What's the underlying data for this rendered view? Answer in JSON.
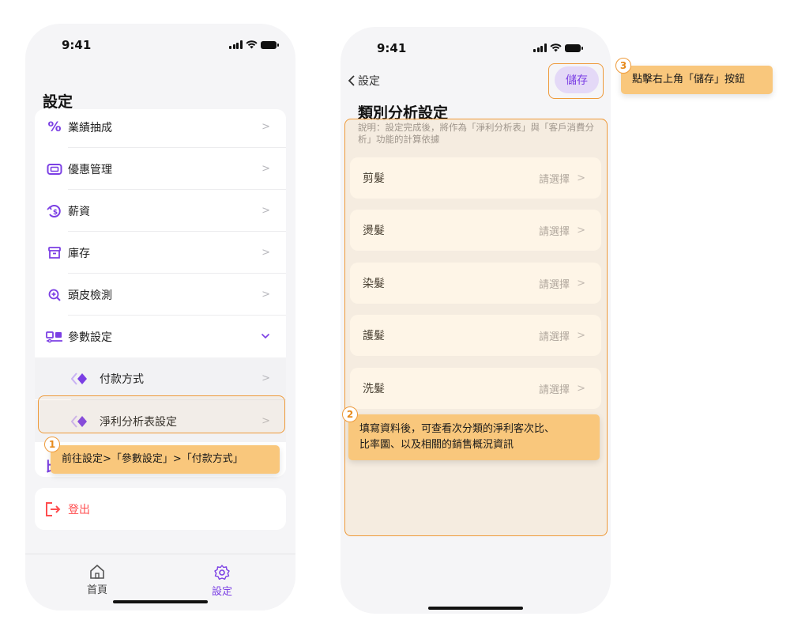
{
  "phone1": {
    "status": {
      "time": "9:41"
    },
    "title": "設定",
    "menu_items": [
      {
        "label": "業績抽成",
        "icon": "percent-icon"
      },
      {
        "label": "優惠管理",
        "icon": "coupon-icon"
      },
      {
        "label": "薪資",
        "icon": "salary-icon"
      },
      {
        "label": "庫存",
        "icon": "inventory-icon"
      },
      {
        "label": "頭皮檢測",
        "icon": "scalp-scan-icon"
      },
      {
        "label": "參數設定",
        "icon": "parameters-icon"
      }
    ],
    "sub_items": [
      {
        "label": "付款方式",
        "icon": "diamond-icon"
      },
      {
        "label": "淨利分析表設定",
        "icon": "diamond-icon"
      }
    ],
    "logout_label": "登出",
    "tabs": [
      {
        "label": "首頁",
        "icon": "home-icon"
      },
      {
        "label": "設定",
        "icon": "gear-icon"
      }
    ]
  },
  "phone2": {
    "status": {
      "time": "9:41"
    },
    "back_label": "設定",
    "save_label": "儲存",
    "title": "類別分析設定",
    "description": "說明：設定完成後，將作為「淨利分析表」與「客戶消費分析」功能的計算依據",
    "placeholder": "請選擇",
    "categories": [
      "剪髮",
      "燙髮",
      "染髮",
      "護髮",
      "洗髮"
    ]
  },
  "annotations": {
    "step1": {
      "number": "1",
      "text": "前往設定>「參數設定」>「付款方式」"
    },
    "step2": {
      "number": "2",
      "line1": "填寫資料後，可查看次分類的淨利客次比、",
      "line2": "比率圖、以及相關的銷售概況資訊"
    },
    "step3": {
      "number": "3",
      "text": "點擊右上角「儲存」按鈕"
    }
  },
  "colors": {
    "accent": "#7b3fe4",
    "danger": "#ff4d4f",
    "highlight": "#ee9a3a",
    "tooltip": "#f9c77c"
  }
}
